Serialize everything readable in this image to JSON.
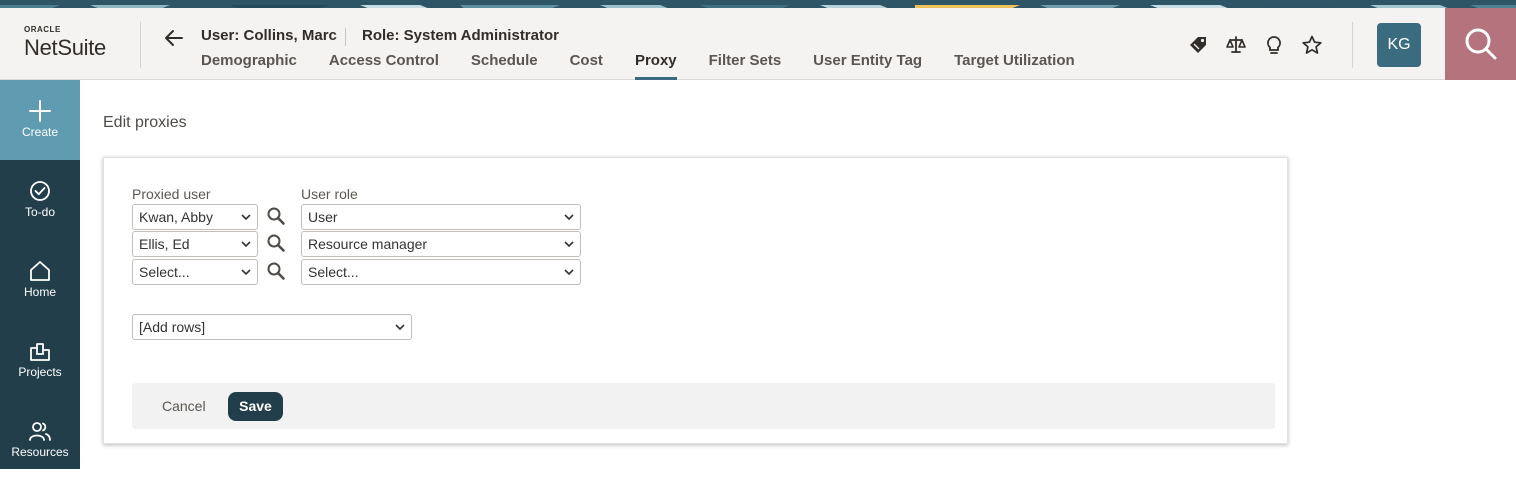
{
  "brand": {
    "oracle": "ORACLE",
    "product": "NetSuite"
  },
  "context": {
    "user": "User: Collins, Marc",
    "role": "Role: System Administrator"
  },
  "tabs": [
    {
      "label": "Demographic",
      "active": false
    },
    {
      "label": "Access Control",
      "active": false
    },
    {
      "label": "Schedule",
      "active": false
    },
    {
      "label": "Cost",
      "active": false
    },
    {
      "label": "Proxy",
      "active": true
    },
    {
      "label": "Filter Sets",
      "active": false
    },
    {
      "label": "User Entity Tag",
      "active": false
    },
    {
      "label": "Target Utilization",
      "active": false
    }
  ],
  "header_icons": [
    "tag-icon",
    "balance-icon",
    "lightbulb-icon",
    "star-icon"
  ],
  "avatar": {
    "initials": "KG"
  },
  "leftnav": [
    {
      "label": "Create",
      "icon": "plus-icon",
      "active": true
    },
    {
      "label": "To-do",
      "icon": "check-circle-icon"
    },
    {
      "label": "Home",
      "icon": "home-icon"
    },
    {
      "label": "Projects",
      "icon": "projects-icon"
    },
    {
      "label": "Resources",
      "icon": "people-icon"
    }
  ],
  "page": {
    "title": "Edit proxies"
  },
  "form": {
    "proxied_user_label": "Proxied user",
    "user_role_label": "User role",
    "rows": [
      {
        "proxied_user": "Kwan, Abby",
        "user_role": "User"
      },
      {
        "proxied_user": "Ellis, Ed",
        "user_role": "Resource manager"
      },
      {
        "proxied_user": "Select...",
        "user_role": "Select..."
      }
    ],
    "add_rows": "[Add rows]"
  },
  "actions": {
    "cancel": "Cancel",
    "save": "Save"
  },
  "colors": {
    "accent": "#3a6b7e",
    "nav_bg": "#223e4b",
    "nav_active": "#5f9cb1",
    "search_tile": "#b5737e",
    "save_button": "#223e4b"
  }
}
